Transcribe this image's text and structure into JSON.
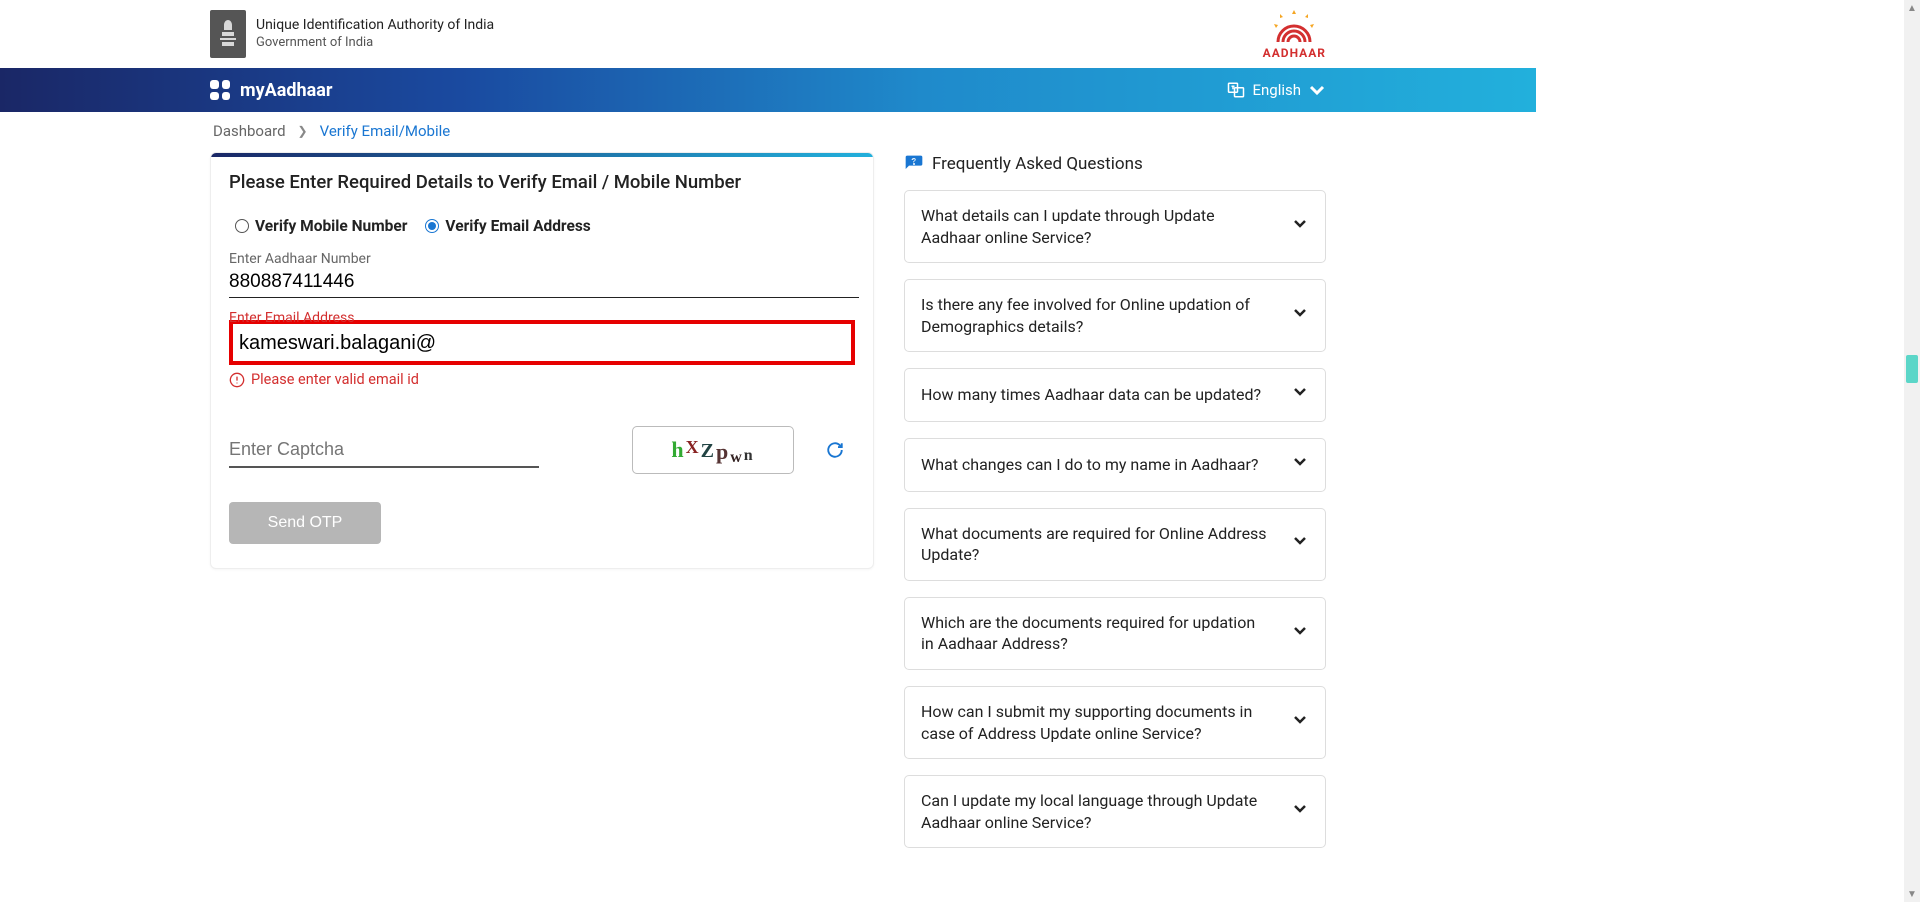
{
  "header": {
    "org_line1": "Unique Identification Authority of India",
    "org_line2": "Government of India",
    "aadhaar_label": "AADHAAR"
  },
  "nav": {
    "brand": "myAadhaar",
    "language": "English"
  },
  "breadcrumb": {
    "dashboard": "Dashboard",
    "current": "Verify Email/Mobile"
  },
  "form": {
    "title": "Please Enter Required Details to Verify Email / Mobile Number",
    "opt_mobile": "Verify Mobile Number",
    "opt_email": "Verify Email Address",
    "aadhaar_label": "Enter Aadhaar Number",
    "aadhaar_value": "880887411446",
    "email_label": "Enter Email Address",
    "email_value": "kameswari.balagani@",
    "error_msg": "Please enter valid email id",
    "captcha_placeholder": "Enter Captcha",
    "captcha_text": "hXZpwn",
    "submit": "Send OTP"
  },
  "faq": {
    "heading": "Frequently Asked Questions",
    "items": [
      "What details can I update through Update Aadhaar online Service?",
      "Is there any fee involved for Online updation of Demographics details?",
      "How many times Aadhaar data can be updated?",
      "What changes can I do to my name in Aadhaar?",
      "What documents are required for Online Address Update?",
      "Which are the documents required for updation in Aadhaar Address?",
      "How can I submit my supporting documents in case of Address Update online Service?",
      "Can I update my local language through Update Aadhaar online Service?"
    ]
  }
}
